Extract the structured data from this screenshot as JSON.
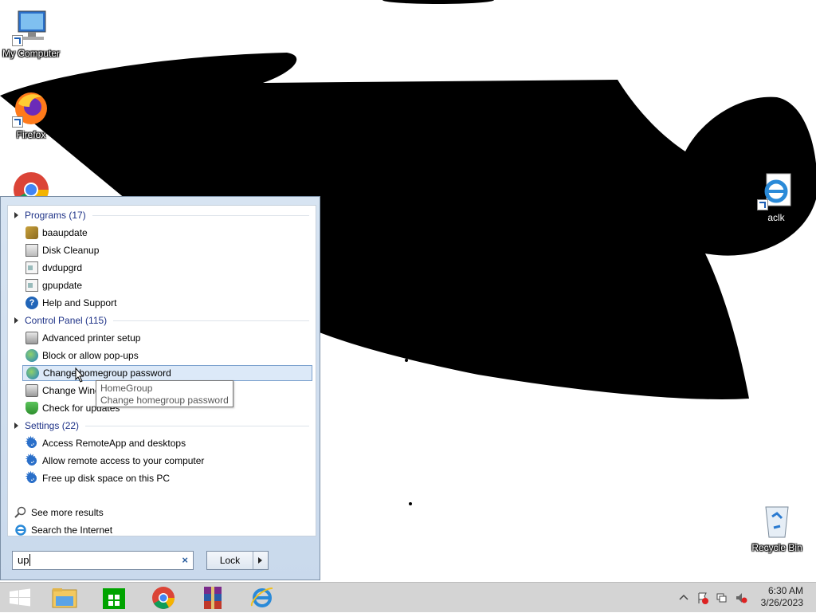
{
  "desktop": {
    "icons": [
      {
        "label": "My Computer"
      },
      {
        "label": "Firefox"
      },
      {
        "label": "aclk"
      },
      {
        "label": "Recycle Bin"
      }
    ]
  },
  "start_menu": {
    "groups": [
      {
        "header": "Programs (17)",
        "items": [
          "baaupdate",
          "Disk Cleanup",
          "dvdupgrd",
          "gpupdate",
          "Help and Support"
        ]
      },
      {
        "header": "Control Panel (115)",
        "items": [
          "Advanced printer setup",
          "Block or allow pop-ups",
          "Change homegroup password",
          "Change Wind",
          "Check for updates"
        ]
      },
      {
        "header": "Settings (22)",
        "items": [
          "Access RemoteApp and desktops",
          "Allow remote access to your computer",
          "Free up disk space on this PC"
        ]
      }
    ],
    "see_more": "See more results",
    "search_internet": "Search the Internet",
    "search_value": "up",
    "search_clear": "×",
    "lock_label": "Lock",
    "tooltip": {
      "line1": "HomeGroup",
      "line2": "Change homegroup password"
    }
  },
  "taskbar": {
    "pinned": [
      "start-icon",
      "file-explorer-icon",
      "store-icon",
      "chrome-icon",
      "winrar-icon",
      "internet-explorer-icon"
    ],
    "clock_time": "6:30 AM",
    "clock_date": "3/26/2023",
    "tray_icons": [
      "show-hidden-icons-icon",
      "action-center-icon",
      "network-icon",
      "volume-muted-icon"
    ]
  },
  "colors": {
    "group_header": "#1e3287",
    "selection": "#dce9f8",
    "taskbar": "#d4d4d4"
  }
}
